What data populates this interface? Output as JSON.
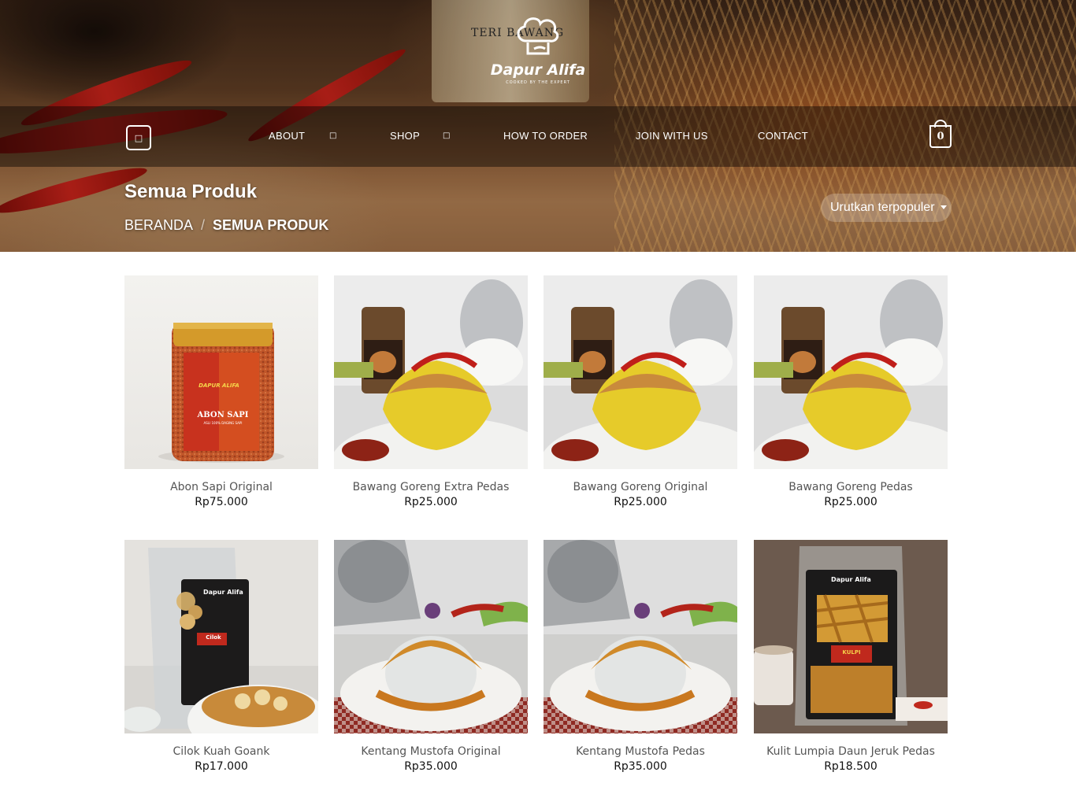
{
  "brand": {
    "name": "Dapur Alifa",
    "tagline": "COOKED BY THE EXPERT"
  },
  "hero": {
    "jar_label": "TERI BAWANG"
  },
  "nav": {
    "items": [
      {
        "label": "ABOUT",
        "has_dropdown": true
      },
      {
        "label": "SHOP",
        "has_dropdown": true
      },
      {
        "label": "HOW TO ORDER",
        "has_dropdown": false
      },
      {
        "label": "JOIN WITH US",
        "has_dropdown": false
      },
      {
        "label": "CONTACT",
        "has_dropdown": false
      }
    ],
    "menu_icon": "menu-icon",
    "caret_icon": "chevron-down-icon",
    "cart_count": "0"
  },
  "page": {
    "title": "Semua Produk",
    "breadcrumb": {
      "home": "BERANDA",
      "separator": "/",
      "current": "SEMUA PRODUK"
    },
    "sort": {
      "selected": "Urutkan terpopuler"
    }
  },
  "products": [
    {
      "name": "Abon Sapi Original",
      "price": "Rp75.000",
      "jar_label": "ABON SAPI",
      "jar_sub": "ASLI 100% DAGING SAPI",
      "jar_brand": "DAPUR ALIFA"
    },
    {
      "name": "Bawang Goreng Extra Pedas",
      "price": "Rp25.000"
    },
    {
      "name": "Bawang Goreng Original",
      "price": "Rp25.000"
    },
    {
      "name": "Bawang Goreng Pedas",
      "price": "Rp25.000"
    },
    {
      "name": "Cilok Kuah Goank",
      "price": "Rp17.000",
      "pack_brand": "Dapur Alifa",
      "pack_label": "Cilok"
    },
    {
      "name": "Kentang Mustofa Original",
      "price": "Rp35.000"
    },
    {
      "name": "Kentang Mustofa Pedas",
      "price": "Rp35.000"
    },
    {
      "name": "Kulit Lumpia Daun Jeruk Pedas",
      "price": "Rp18.500",
      "pack_brand": "Dapur Alifa",
      "pack_label": "KULPI"
    }
  ],
  "colors": {
    "nav_band": "#000000",
    "title_text": "#ffffff",
    "price_text": "#111111",
    "name_text": "#555555"
  }
}
